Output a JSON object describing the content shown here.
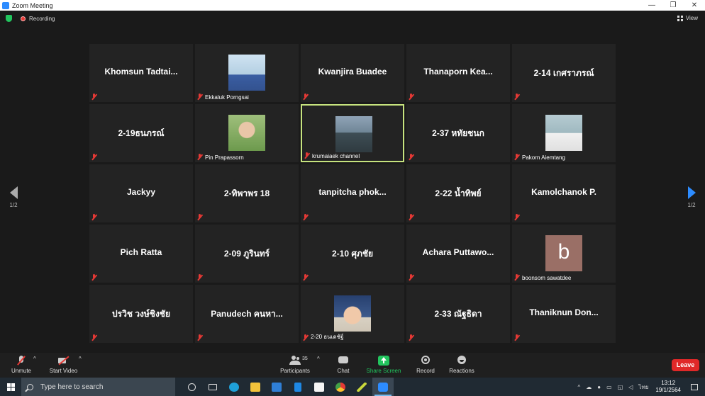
{
  "window": {
    "title": "Zoom Meeting"
  },
  "top_bar": {
    "recording_label": "Recording",
    "view_label": "View"
  },
  "pagination": {
    "left": "1/2",
    "right": "1/2"
  },
  "tiles": [
    {
      "name": "Khomsun  Tadtai...",
      "caption": "",
      "photo": ""
    },
    {
      "name": "",
      "caption": "Ekkaluk Porngsai",
      "photo": "p-male"
    },
    {
      "name": "Kwanjira Buadee",
      "caption": "",
      "photo": ""
    },
    {
      "name": "Thanaporn  Kea...",
      "caption": "",
      "photo": ""
    },
    {
      "name": "2-14 เกศราภรณ์",
      "caption": "",
      "photo": ""
    },
    {
      "name": "2-19ธนภรณ์",
      "caption": "",
      "photo": ""
    },
    {
      "name": "",
      "caption": "Pin Prapassorn",
      "photo": "p-female"
    },
    {
      "name": "",
      "caption": "krumaiaek channel",
      "photo": "p-krum",
      "active": true
    },
    {
      "name": "2-37 หทัยชนก",
      "caption": "",
      "photo": ""
    },
    {
      "name": "",
      "caption": "Pakorn Aiemtang",
      "photo": "p-pakorn"
    },
    {
      "name": "Jackyy",
      "caption": "",
      "photo": ""
    },
    {
      "name": "2-ทิพาพร 18",
      "caption": "",
      "photo": ""
    },
    {
      "name": "tanpitcha  phok...",
      "caption": "",
      "photo": ""
    },
    {
      "name": "2-22 น้ำทิพย์",
      "caption": "",
      "photo": ""
    },
    {
      "name": "Kamolchanok P.",
      "caption": "",
      "photo": ""
    },
    {
      "name": "Pich Ratta",
      "caption": "",
      "photo": ""
    },
    {
      "name": "2-09 ภูรินทร์",
      "caption": "",
      "photo": ""
    },
    {
      "name": "2-10 ศุภชัย",
      "caption": "",
      "photo": ""
    },
    {
      "name": "Achara  Puttawo...",
      "caption": "",
      "photo": ""
    },
    {
      "name": "",
      "caption": "boonsom sawatdee",
      "photo": "",
      "letter": "b"
    },
    {
      "name": "ปรวิช วงษ์ชิงชัย",
      "caption": "",
      "photo": ""
    },
    {
      "name": "Panudech คนหา...",
      "caption": "",
      "photo": ""
    },
    {
      "name": "",
      "caption": "2-20 ธนเดชัฐ์",
      "photo": "p-maew"
    },
    {
      "name": "2-33 ณัฐธิดา",
      "caption": "",
      "photo": ""
    },
    {
      "name": "Thaniknun  Don...",
      "caption": "",
      "photo": ""
    }
  ],
  "controls": {
    "unmute": "Unmute",
    "start_video": "Start Video",
    "participants": "Participants",
    "participants_count": "35",
    "chat": "Chat",
    "share_screen": "Share Screen",
    "record": "Record",
    "reactions": "Reactions",
    "leave": "Leave"
  },
  "taskbar": {
    "search_placeholder": "Type here to search",
    "language": "ไทย",
    "time": "13:12",
    "date": "19/1/2564"
  },
  "colors": {
    "active_speaker_border": "#c6e37e",
    "share_green": "#22c55e",
    "leave_red": "#e02828",
    "muted_red": "#e53935",
    "accent_blue": "#2d8cff"
  }
}
